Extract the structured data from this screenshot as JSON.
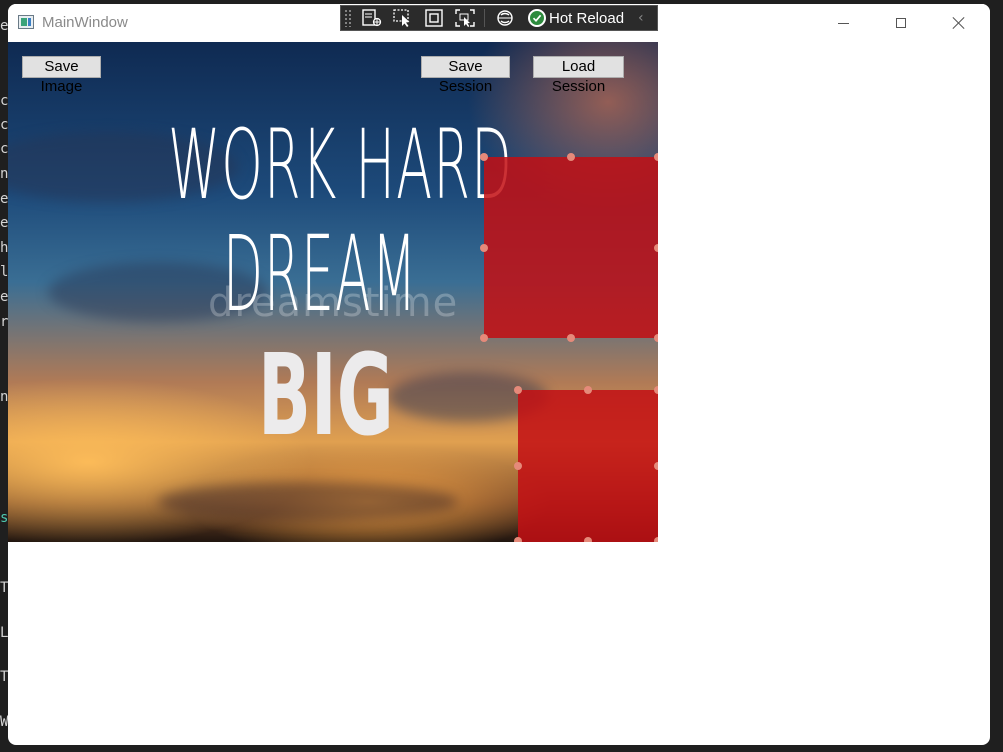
{
  "background_editor": {
    "lines": [
      {
        "text": "e"
      },
      {
        "text": "c"
      },
      {
        "text": "c"
      },
      {
        "text": "c"
      },
      {
        "text": "n"
      },
      {
        "text": "e"
      },
      {
        "text": "e"
      },
      {
        "text": "h"
      },
      {
        "text": "l"
      },
      {
        "text": "e"
      },
      {
        "text": "r"
      },
      {
        "text": "n"
      },
      {
        "text": "s",
        "color": "#4ec9b0"
      },
      {
        "text": "T"
      },
      {
        "text": "L"
      },
      {
        "text": "T"
      },
      {
        "text": "W"
      }
    ]
  },
  "window": {
    "title": "MainWindow",
    "controls": [
      "minimize-icon",
      "maximize-icon",
      "close-icon"
    ]
  },
  "dev_toolbar": {
    "icons": [
      "live-visual-tree-icon",
      "select-element-icon",
      "display-layout-adorners-icon",
      "track-focus-icon",
      "binding-failures-icon"
    ],
    "hot_reload_label": "Hot Reload",
    "hot_reload_status_icon": "check-circle-icon",
    "collapse_icon": "chevron-left-icon"
  },
  "toolbar": {
    "save_image_label": "Save Image",
    "save_session_label": "Save Session",
    "load_session_label": "Load Session"
  },
  "image": {
    "line1": "WORK HARD",
    "line2": "DREAM",
    "line3": "BIG",
    "watermark": "dreamstime"
  },
  "colors": {
    "overlay_red": "#c30f14",
    "handle": "#e58a7a",
    "hot_reload_green": "#2e8b3e"
  }
}
